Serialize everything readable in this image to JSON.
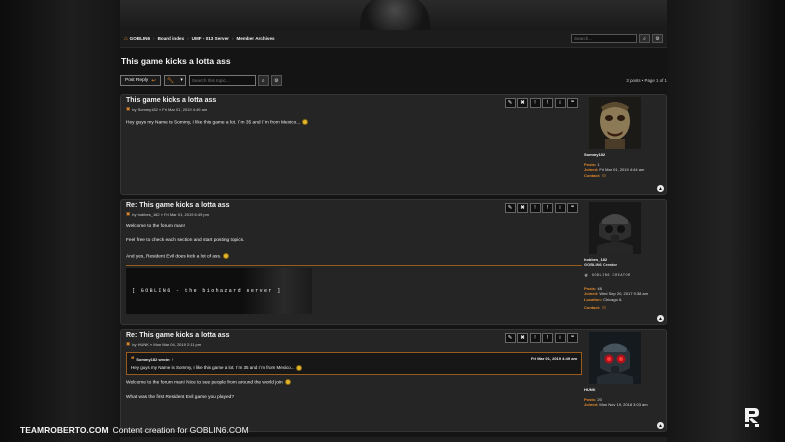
{
  "breadcrumbs": [
    "GOBLIN6",
    "Board index",
    "UMF - 013 Server",
    "Member Archives"
  ],
  "search": {
    "placeholder": "Search..."
  },
  "topic": {
    "title": "This game kicks a lotta ass",
    "post_reply": "Post Reply",
    "search_placeholder": "Search this topic...",
    "pagination": "3 posts • Page 1 of 1"
  },
  "posts": [
    {
      "title": "This game kicks a lotta ass",
      "meta": "by Sommy182 » Fri Mar 01, 2019 4:49 am",
      "content": [
        "Hey guys my Name is Sommy, I like this game a lot. I´m 35 and I´m from Mexico..."
      ],
      "profile": {
        "username": "Sommy182",
        "posts_label": "Posts:",
        "posts": "1",
        "joined_label": "Joined:",
        "joined": "Fri Mar 01, 2019 4:44 am",
        "contact_label": "Contact:"
      }
    },
    {
      "title": "Re: This game kicks a lotta ass",
      "meta": "by hobbes_182 » Fri Mar 01, 2019 6:49 pm",
      "content": [
        "Welcome to the forum man!",
        "Feel free to check each section and start posting topics.",
        "And yes, Resident Evil does kick a lot of ass."
      ],
      "signature": "[ GOBLIN6 - the biohazard server ]",
      "profile": {
        "username": "hobbes_182",
        "rank": "GOBLIN6 Creator",
        "rank_image_text": "GOBLIN6 CREATOR",
        "posts_label": "Posts:",
        "posts": "48",
        "joined_label": "Joined:",
        "joined": "Wed Sep 20, 2017 9:38 am",
        "location_label": "Location:",
        "location": "Chicago IL",
        "contact_label": "Contact:"
      }
    },
    {
      "title": "Re: This game kicks a lotta ass",
      "meta": "by HUNK » Mon Mar 04, 2019 2:11 pm",
      "quote": {
        "author": "Sommy182 wrote: ↑",
        "date": "Fri Mar 01, 2019 4:49 am",
        "text": "Hey guys my Name is Sommy, I like this game a lot. I´m 35 and I´m from Mexico..."
      },
      "content": [
        "Welcome to the forum man! Nice to see people from around the world join",
        "What was the first Resident Evil game you played?"
      ],
      "profile": {
        "username": "HUNK",
        "posts_label": "Posts:",
        "posts": "20",
        "joined_label": "Joined:",
        "joined": "Mon Nov 19, 2018 3:03 am"
      }
    }
  ],
  "watermark": {
    "brand": "TEAMROBERTO.COM",
    "tagline": "Content creation for GOBLIN6.COM"
  },
  "colors": {
    "accent": "#e28a2b",
    "panel": "#252525",
    "background": "#141414"
  },
  "icons": [
    "home-icon",
    "search-icon",
    "gear-icon",
    "reply-arrow-icon",
    "wrench-icon",
    "edit-icon",
    "delete-icon",
    "report-icon",
    "warn-icon",
    "info-icon",
    "quote-icon",
    "contact-icon",
    "back-to-top-icon"
  ]
}
